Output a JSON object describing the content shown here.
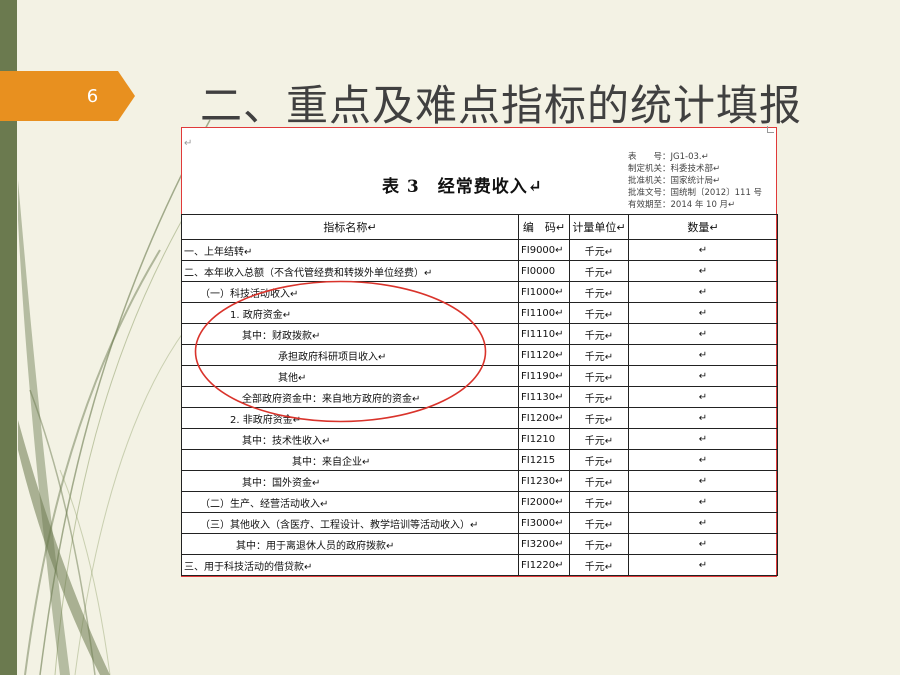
{
  "slide": {
    "number": "6",
    "title": "二、重点及难点指标的统计填报",
    "accent_color": "#e8901f",
    "sidebar_color": "#6b7a4f"
  },
  "document": {
    "return_mark": "↵",
    "table_title": "表 3　经常费收入↵",
    "meta": [
      "表　　号：JG1-03.↵",
      "制定机关：科委技术部↵",
      "批准机关：国家统计局↵",
      "批准文号：国统制〔2012〕111 号",
      "有效期至：2014 年 10 月↵"
    ],
    "columns": [
      "指标名称↵",
      "编　码↵",
      "计量单位↵",
      "数量↵"
    ],
    "rows": [
      {
        "name": "一、上年结转↵",
        "code": "FI9000↵",
        "unit": "千元↵",
        "qty": "↵",
        "bold": true,
        "indent": 0
      },
      {
        "name": "二、本年收入总额（不含代管经费和转拨外单位经费）↵",
        "code": "FI0000",
        "unit": "千元↵",
        "qty": "↵",
        "bold": true,
        "indent": 0
      },
      {
        "name": "（一）科技活动收入↵",
        "code": "FI1000↵",
        "unit": "千元↵",
        "qty": "↵",
        "bold": false,
        "indent": 16
      },
      {
        "name": "1. 政府资金↵",
        "code": "FI1100↵",
        "unit": "千元↵",
        "qty": "↵",
        "bold": false,
        "indent": 46
      },
      {
        "name": "其中：财政拨款↵",
        "code": "FI1110↵",
        "unit": "千元↵",
        "qty": "↵",
        "bold": false,
        "indent": 58
      },
      {
        "name": "承担政府科研项目收入↵",
        "code": "FI1120↵",
        "unit": "千元↵",
        "qty": "↵",
        "bold": false,
        "indent": 94
      },
      {
        "name": "其他↵",
        "code": "FI1190↵",
        "unit": "千元↵",
        "qty": "↵",
        "bold": false,
        "indent": 94
      },
      {
        "name": "全部政府资金中：来自地方政府的资金↵",
        "code": "FI1130↵",
        "unit": "千元↵",
        "qty": "↵",
        "bold": false,
        "indent": 58
      },
      {
        "name": "2. 非政府资金↵",
        "code": "FI1200↵",
        "unit": "千元↵",
        "qty": "↵",
        "bold": false,
        "indent": 46
      },
      {
        "name": "其中：技术性收入↵",
        "code": "FI1210",
        "unit": "千元↵",
        "qty": "↵",
        "bold": false,
        "indent": 58
      },
      {
        "name": "其中：来自企业↵",
        "code": "FI1215",
        "unit": "千元↵",
        "qty": "↵",
        "bold": false,
        "indent": 108
      },
      {
        "name": "其中：国外资金↵",
        "code": "FI1230↵",
        "unit": "千元↵",
        "qty": "↵",
        "bold": false,
        "indent": 58
      },
      {
        "name": "（二）生产、经营活动收入↵",
        "code": "FI2000↵",
        "unit": "千元↵",
        "qty": "↵",
        "bold": false,
        "indent": 16
      },
      {
        "name": "（三）其他收入（含医疗、工程设计、教学培训等活动收入）↵",
        "code": "FI3000↵",
        "unit": "千元↵",
        "qty": "↵",
        "bold": false,
        "indent": 16
      },
      {
        "name": "其中：用于离退休人员的政府拨款↵",
        "code": "FI3200↵",
        "unit": "千元↵",
        "qty": "↵",
        "bold": false,
        "indent": 52
      },
      {
        "name": "三、用于科技活动的借贷款↵",
        "code": "FI1220↵",
        "unit": "千元↵",
        "qty": "↵",
        "bold": true,
        "indent": 0
      }
    ]
  },
  "annotation_color": "#d9332b"
}
